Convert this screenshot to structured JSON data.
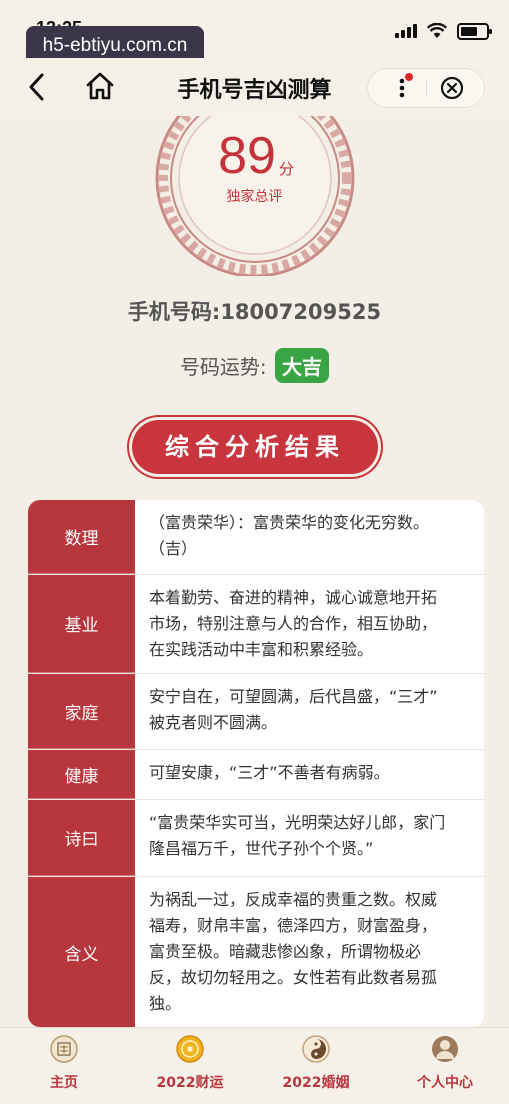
{
  "status": {
    "time": "13:25"
  },
  "url": "h5-ebtiyu.com.cn",
  "nav": {
    "title": "手机号吉凶测算"
  },
  "score": {
    "value": "89",
    "unit": "分",
    "caption": "独家总评"
  },
  "phone": {
    "label": "手机号码:18007209525"
  },
  "fortune": {
    "label": "号码运势:",
    "badge": "大吉"
  },
  "section_title": "综合分析结果",
  "rows": [
    {
      "label": "数理",
      "value": "（富贵荣华）：富贵荣华的变化无穷数。\n（吉）"
    },
    {
      "label": "基业",
      "value": "本着勤劳、奋进的精神，诚心诚意地开拓\n市场，特别注意与人的合作，相互协助，\n在实践活动中丰富和积累经验。"
    },
    {
      "label": "家庭",
      "value": "安宁自在，可望圆满，后代昌盛，“三才”\n被克者则不圆满。"
    },
    {
      "label": "健康",
      "value": "可望安康，“三才”不善者有病弱。"
    },
    {
      "label": "诗曰",
      "value": "“富贵荣华实可当，光明荣达好儿郎，家门\n隆昌福万千，世代子孙个个贤。”"
    },
    {
      "label": "含义",
      "value": "为祸乱一过，反成幸福的贵重之数。权威\n福寿，财帛丰富，德泽四方，财富盈身，\n富贵至极。暗藏悲惨凶象，所谓物极必\n反，故切勿轻用之。女性若有此数者易孤\n独。"
    }
  ],
  "tabs": [
    {
      "label": "主页",
      "icon": "home-seal-icon"
    },
    {
      "label": "2022财运",
      "icon": "coin-icon"
    },
    {
      "label": "2022婚姻",
      "icon": "yin-yang-icon"
    },
    {
      "label": "个人中心",
      "icon": "user-icon"
    }
  ],
  "colors": {
    "accent": "#c5323a",
    "badge": "#3aa545",
    "background": "#f4efe6"
  }
}
